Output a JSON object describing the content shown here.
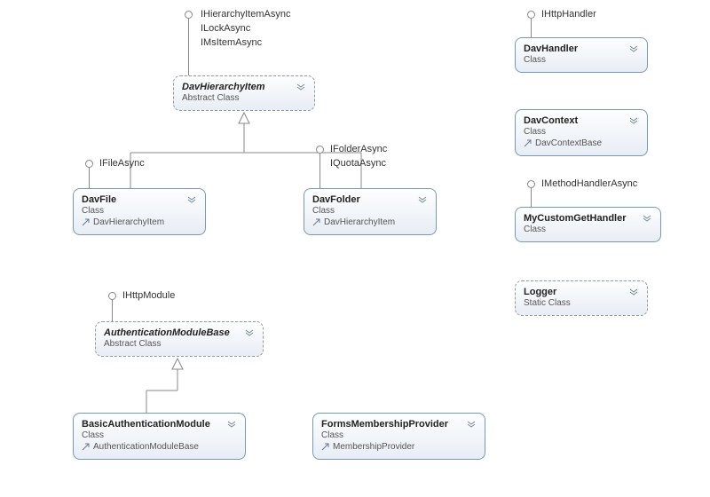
{
  "classes": {
    "davHierarchyItem": {
      "name": "DavHierarchyItem",
      "stereotype": "Abstract Class",
      "interfaces": [
        "IHierarchyItemAsync",
        "ILockAsync",
        "IMsItemAsync"
      ]
    },
    "davFile": {
      "name": "DavFile",
      "stereotype": "Class",
      "base": "DavHierarchyItem",
      "interfaces": [
        "IFileAsync"
      ]
    },
    "davFolder": {
      "name": "DavFolder",
      "stereotype": "Class",
      "base": "DavHierarchyItem",
      "interfaces": [
        "IFolderAsync",
        "IQuotaAsync"
      ]
    },
    "authModuleBase": {
      "name": "AuthenticationModuleBase",
      "stereotype": "Abstract Class",
      "interfaces": [
        "IHttpModule"
      ]
    },
    "basicAuth": {
      "name": "BasicAuthenticationModule",
      "stereotype": "Class",
      "base": "AuthenticationModuleBase"
    },
    "formsMembership": {
      "name": "FormsMembershipProvider",
      "stereotype": "Class",
      "base": "MembershipProvider"
    },
    "davHandler": {
      "name": "DavHandler",
      "stereotype": "Class",
      "interfaces": [
        "IHttpHandler"
      ]
    },
    "davContext": {
      "name": "DavContext",
      "stereotype": "Class",
      "base": "DavContextBase"
    },
    "myCustomGet": {
      "name": "MyCustomGetHandler",
      "stereotype": "Class",
      "interfaces": [
        "IMethodHandlerAsync"
      ]
    },
    "logger": {
      "name": "Logger",
      "stereotype": "Static Class"
    }
  },
  "chart_data": {
    "type": "class-diagram",
    "nodes": [
      {
        "id": "DavHierarchyItem",
        "kind": "abstract",
        "implements": [
          "IHierarchyItemAsync",
          "ILockAsync",
          "IMsItemAsync"
        ]
      },
      {
        "id": "DavFile",
        "kind": "class",
        "extends": "DavHierarchyItem",
        "implements": [
          "IFileAsync"
        ]
      },
      {
        "id": "DavFolder",
        "kind": "class",
        "extends": "DavHierarchyItem",
        "implements": [
          "IFolderAsync",
          "IQuotaAsync"
        ]
      },
      {
        "id": "AuthenticationModuleBase",
        "kind": "abstract",
        "implements": [
          "IHttpModule"
        ]
      },
      {
        "id": "BasicAuthenticationModule",
        "kind": "class",
        "extends": "AuthenticationModuleBase"
      },
      {
        "id": "FormsMembershipProvider",
        "kind": "class",
        "extends": "MembershipProvider"
      },
      {
        "id": "DavHandler",
        "kind": "class",
        "implements": [
          "IHttpHandler"
        ]
      },
      {
        "id": "DavContext",
        "kind": "class",
        "extends": "DavContextBase"
      },
      {
        "id": "MyCustomGetHandler",
        "kind": "class",
        "implements": [
          "IMethodHandlerAsync"
        ]
      },
      {
        "id": "Logger",
        "kind": "static"
      }
    ],
    "edges": [
      {
        "from": "DavFile",
        "to": "DavHierarchyItem",
        "type": "inherit"
      },
      {
        "from": "DavFolder",
        "to": "DavHierarchyItem",
        "type": "inherit"
      },
      {
        "from": "BasicAuthenticationModule",
        "to": "AuthenticationModuleBase",
        "type": "inherit"
      }
    ]
  }
}
